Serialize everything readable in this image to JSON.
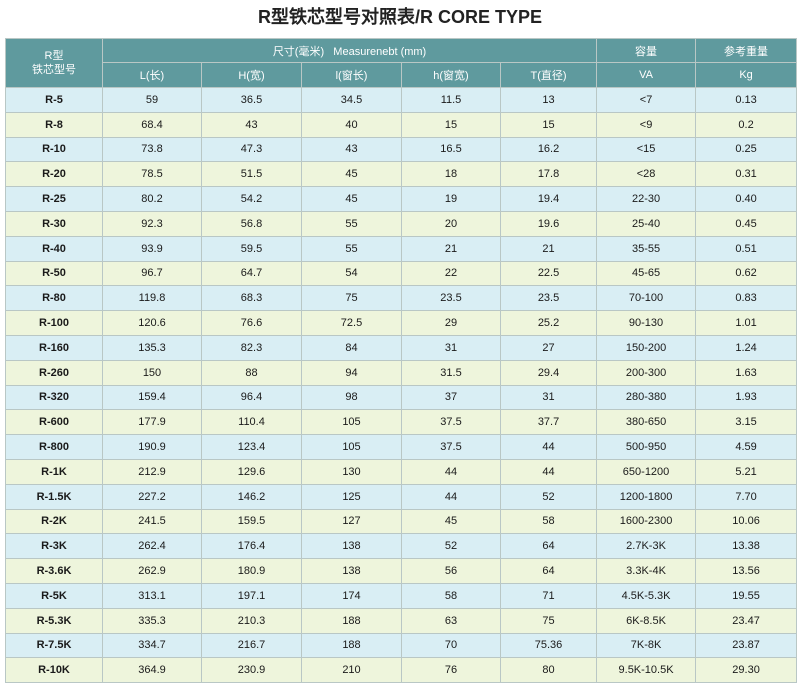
{
  "title": "R型铁芯型号对照表/R CORE TYPE",
  "header": {
    "model_line1": "R型",
    "model_line2": "铁芯型号",
    "dimensions": "尺寸(毫米)   Measurenebt (mm)",
    "capacity": "容量",
    "weight": "参考重量",
    "cols": [
      "L(长)",
      "H(宽)",
      "l(窗长)",
      "h(窗宽)",
      "T(直径)"
    ],
    "va": "VA",
    "kg": "Kg"
  },
  "rows": [
    [
      "R-5",
      "59",
      "36.5",
      "34.5",
      "11.5",
      "13",
      "<7",
      "0.13"
    ],
    [
      "R-8",
      "68.4",
      "43",
      "40",
      "15",
      "15",
      "<9",
      "0.2"
    ],
    [
      "R-10",
      "73.8",
      "47.3",
      "43",
      "16.5",
      "16.2",
      "<15",
      "0.25"
    ],
    [
      "R-20",
      "78.5",
      "51.5",
      "45",
      "18",
      "17.8",
      "<28",
      "0.31"
    ],
    [
      "R-25",
      "80.2",
      "54.2",
      "45",
      "19",
      "19.4",
      "22-30",
      "0.40"
    ],
    [
      "R-30",
      "92.3",
      "56.8",
      "55",
      "20",
      "19.6",
      "25-40",
      "0.45"
    ],
    [
      "R-40",
      "93.9",
      "59.5",
      "55",
      "21",
      "21",
      "35-55",
      "0.51"
    ],
    [
      "R-50",
      "96.7",
      "64.7",
      "54",
      "22",
      "22.5",
      "45-65",
      "0.62"
    ],
    [
      "R-80",
      "119.8",
      "68.3",
      "75",
      "23.5",
      "23.5",
      "70-100",
      "0.83"
    ],
    [
      "R-100",
      "120.6",
      "76.6",
      "72.5",
      "29",
      "25.2",
      "90-130",
      "1.01"
    ],
    [
      "R-160",
      "135.3",
      "82.3",
      "84",
      "31",
      "27",
      "150-200",
      "1.24"
    ],
    [
      "R-260",
      "150",
      "88",
      "94",
      "31.5",
      "29.4",
      "200-300",
      "1.63"
    ],
    [
      "R-320",
      "159.4",
      "96.4",
      "98",
      "37",
      "31",
      "280-380",
      "1.93"
    ],
    [
      "R-600",
      "177.9",
      "110.4",
      "105",
      "37.5",
      "37.7",
      "380-650",
      "3.15"
    ],
    [
      "R-800",
      "190.9",
      "123.4",
      "105",
      "37.5",
      "44",
      "500-950",
      "4.59"
    ],
    [
      "R-1K",
      "212.9",
      "129.6",
      "130",
      "44",
      "44",
      "650-1200",
      "5.21"
    ],
    [
      "R-1.5K",
      "227.2",
      "146.2",
      "125",
      "44",
      "52",
      "1200-1800",
      "7.70"
    ],
    [
      "R-2K",
      "241.5",
      "159.5",
      "127",
      "45",
      "58",
      "1600-2300",
      "10.06"
    ],
    [
      "R-3K",
      "262.4",
      "176.4",
      "138",
      "52",
      "64",
      "2.7K-3K",
      "13.38"
    ],
    [
      "R-3.6K",
      "262.9",
      "180.9",
      "138",
      "56",
      "64",
      "3.3K-4K",
      "13.56"
    ],
    [
      "R-5K",
      "313.1",
      "197.1",
      "174",
      "58",
      "71",
      "4.5K-5.3K",
      "19.55"
    ],
    [
      "R-5.3K",
      "335.3",
      "210.3",
      "188",
      "63",
      "75",
      "6K-8.5K",
      "23.47"
    ],
    [
      "R-7.5K",
      "334.7",
      "216.7",
      "188",
      "70",
      "75.36",
      "7K-8K",
      "23.87"
    ],
    [
      "R-10K",
      "364.9",
      "230.9",
      "210",
      "76",
      "80",
      "9.5K-10.5K",
      "29.30"
    ]
  ]
}
